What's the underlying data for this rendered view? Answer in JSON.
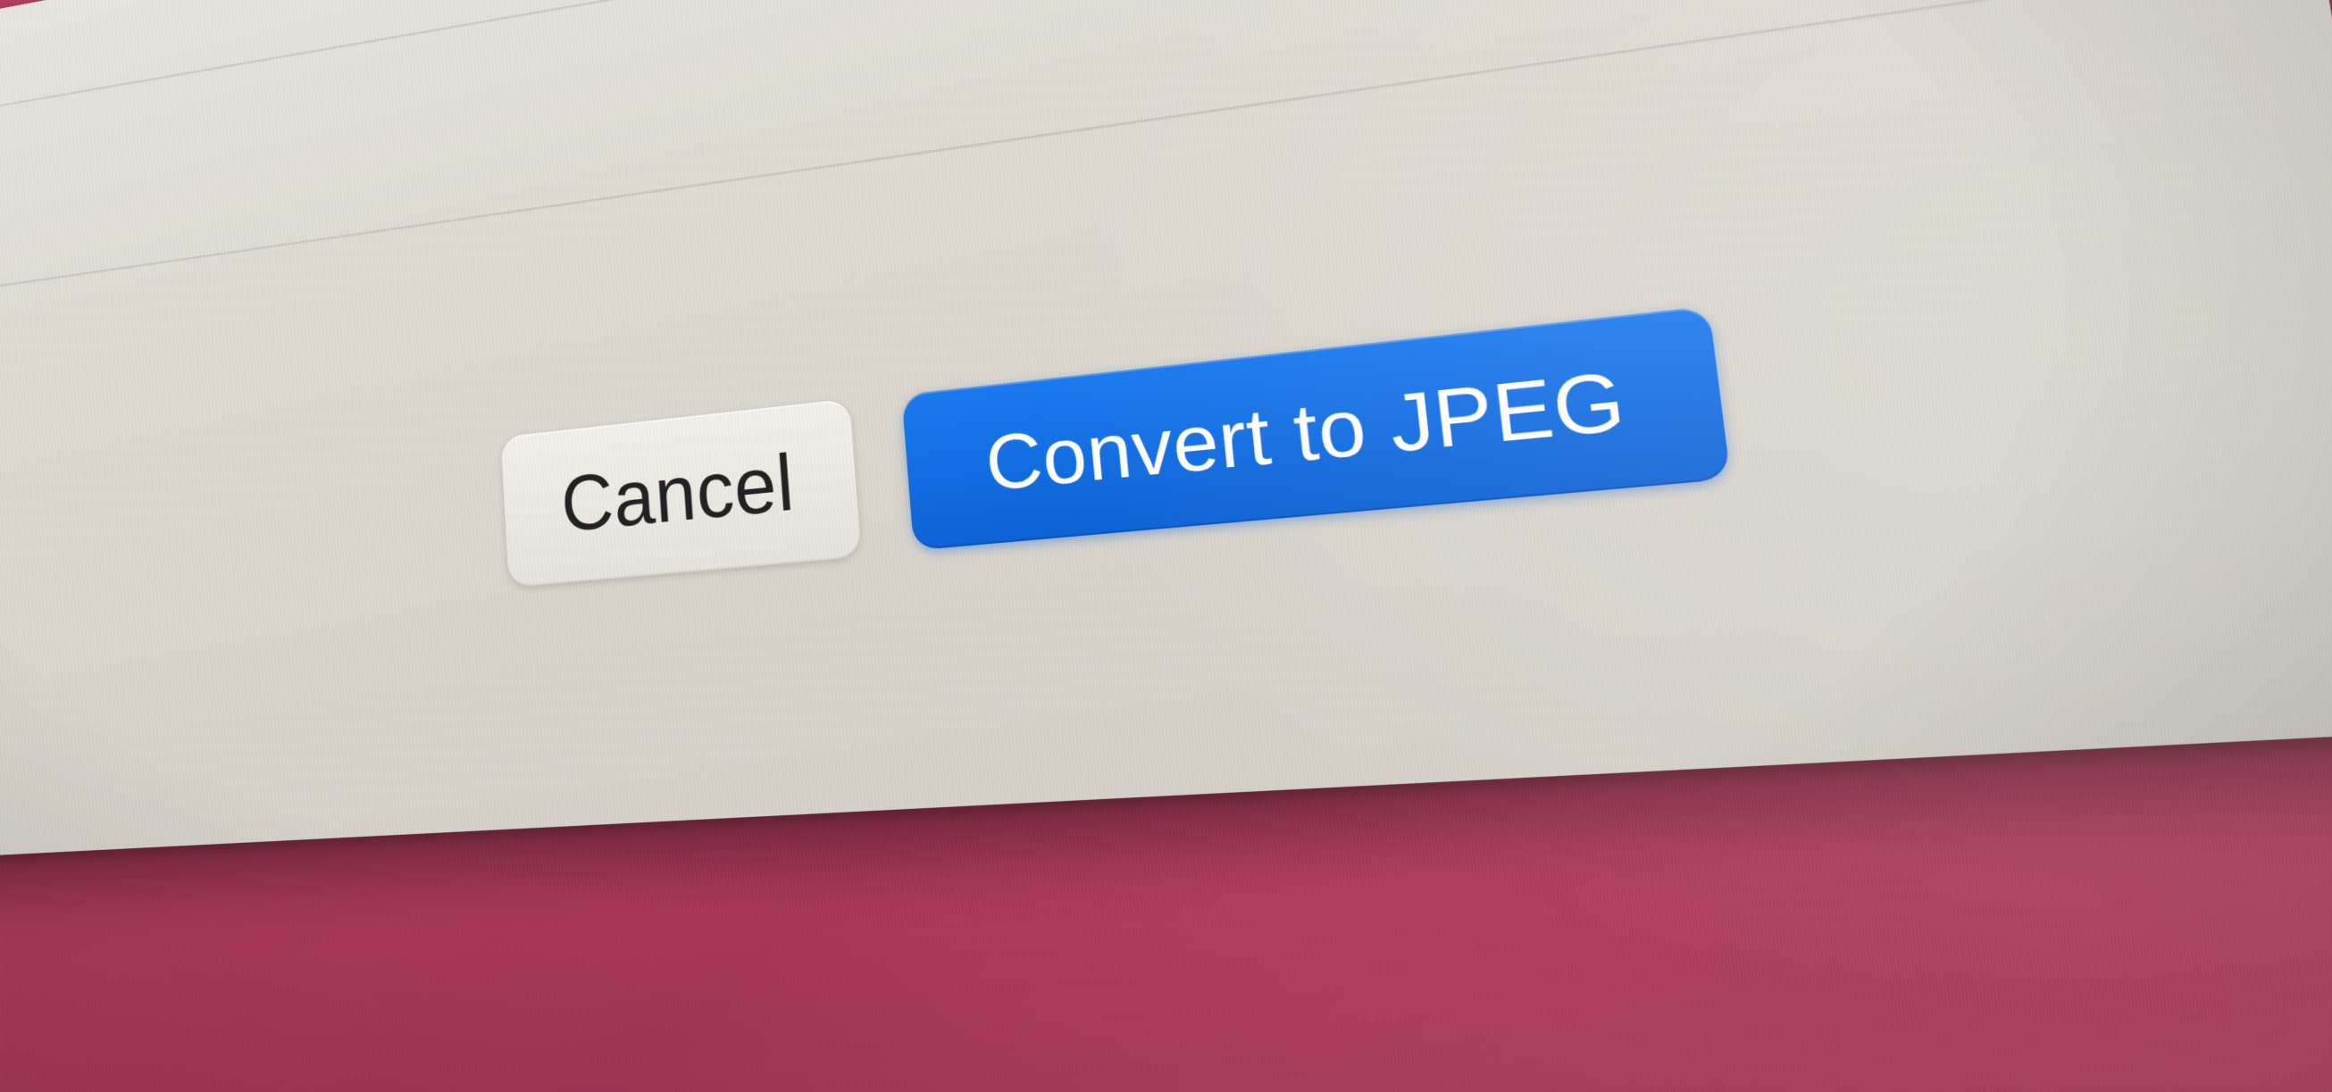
{
  "dialog": {
    "buttons": {
      "cancel_label": "Cancel",
      "confirm_label": "Convert to JPEG"
    },
    "colors": {
      "primary_button_bg": "#0d63d6",
      "primary_button_text": "#ffffff",
      "secondary_button_bg": "#e6e3dc",
      "secondary_button_text": "#222222",
      "window_bg": "#dedad2"
    }
  }
}
